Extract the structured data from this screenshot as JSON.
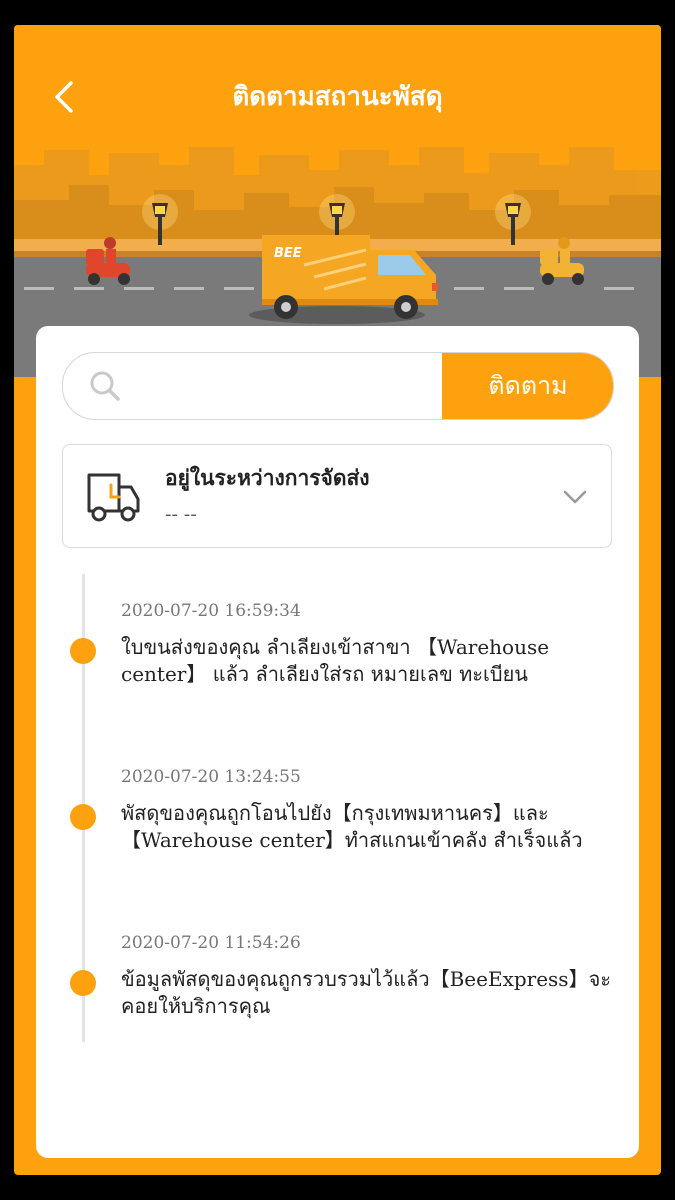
{
  "header": {
    "title": "ติดตามสถานะพัสดุ",
    "back_icon": "chevron-left-icon",
    "truck_logo": "BEE"
  },
  "search": {
    "value": "",
    "placeholder": "",
    "button_label": "ติดตาม"
  },
  "status": {
    "title": "อยู่ในระหว่างการจัดส่ง",
    "subtitle": "-- --"
  },
  "timeline": [
    {
      "time": "2020-07-20 16:59:34",
      "description": "ใบขนส่งของคุณ ลำเลียงเข้าสาขา 【Warehouse center】 แล้ว ลำเลียงใส่รถ หมายเลข ทะเบียน"
    },
    {
      "time": "2020-07-20 13:24:55",
      "description": "พัสดุของคุณถูกโอนไปยัง【กรุงเทพมหานคร】และ【Warehouse center】ทำสแกนเข้าคลัง สำเร็จแล้ว"
    },
    {
      "time": "2020-07-20 11:54:26",
      "description": "ข้อมูลพัสดุของคุณถูกรวบรวมไว้แล้ว【BeeExpress】จะคอยให้บริการคุณ"
    }
  ],
  "colors": {
    "accent": "#fda10e",
    "background": "#000000",
    "road": "#7a7a7a"
  }
}
